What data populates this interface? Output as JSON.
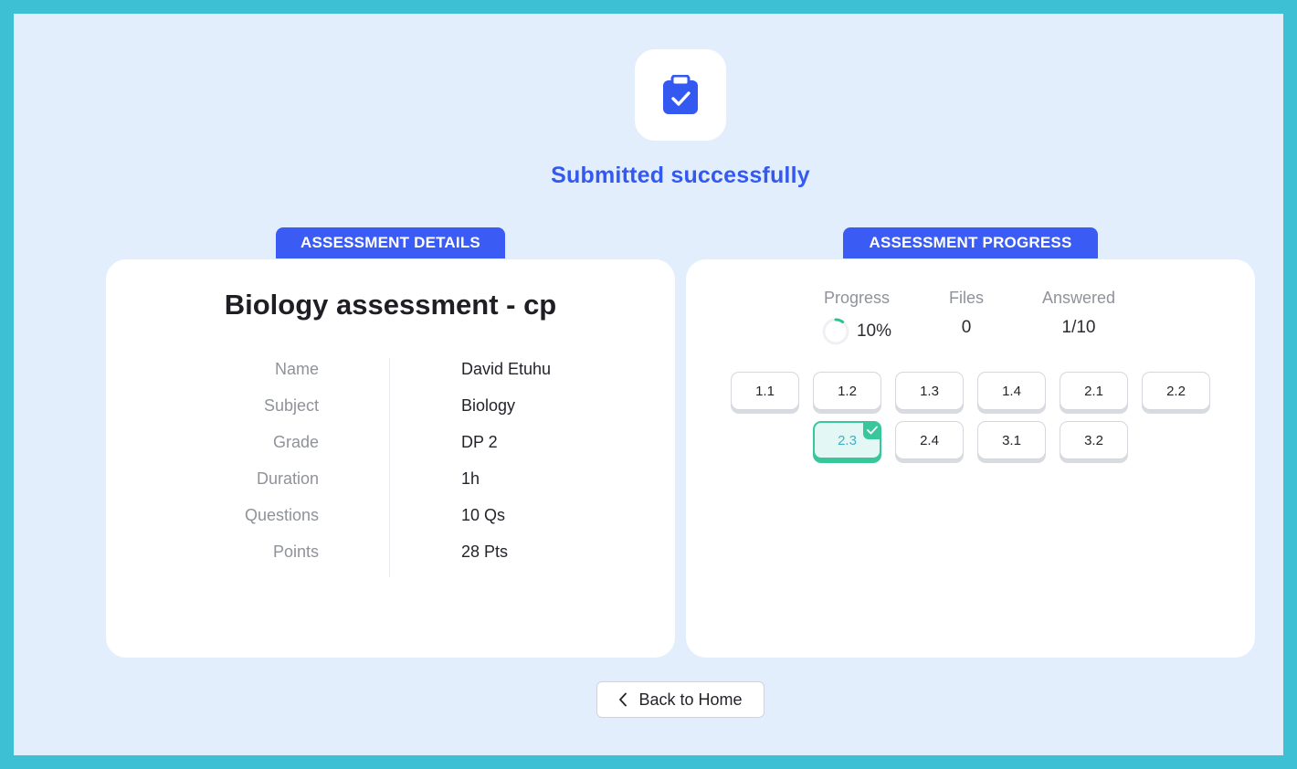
{
  "header": {
    "icon": "clipboard-check-icon",
    "title": "Submitted successfully",
    "accent_color": "#3359f0"
  },
  "details": {
    "tab_label": "ASSESSMENT DETAILS",
    "title": "Biology assessment - cp",
    "rows": [
      {
        "label": "Name",
        "value": "David Etuhu"
      },
      {
        "label": "Subject",
        "value": "Biology"
      },
      {
        "label": "Grade",
        "value": "DP 2"
      },
      {
        "label": "Duration",
        "value": "1h"
      },
      {
        "label": "Questions",
        "value": "10 Qs"
      },
      {
        "label": "Points",
        "value": "28 Pts"
      }
    ]
  },
  "progress": {
    "tab_label": "ASSESSMENT PROGRESS",
    "stats": {
      "progress_label": "Progress",
      "progress_value": "10%",
      "progress_fraction": 0.1,
      "files_label": "Files",
      "files_value": "0",
      "answered_label": "Answered",
      "answered_value": "1/10"
    },
    "questions": [
      {
        "label": "1.1",
        "answered": false
      },
      {
        "label": "1.2",
        "answered": false
      },
      {
        "label": "1.3",
        "answered": false
      },
      {
        "label": "1.4",
        "answered": false
      },
      {
        "label": "2.1",
        "answered": false
      },
      {
        "label": "2.2",
        "answered": false
      },
      {
        "label": "2.3",
        "answered": true
      },
      {
        "label": "2.4",
        "answered": false
      },
      {
        "label": "3.1",
        "answered": false
      },
      {
        "label": "3.2",
        "answered": false
      }
    ]
  },
  "footer": {
    "back_label": "Back to Home",
    "back_icon": "chevron-left-icon"
  }
}
